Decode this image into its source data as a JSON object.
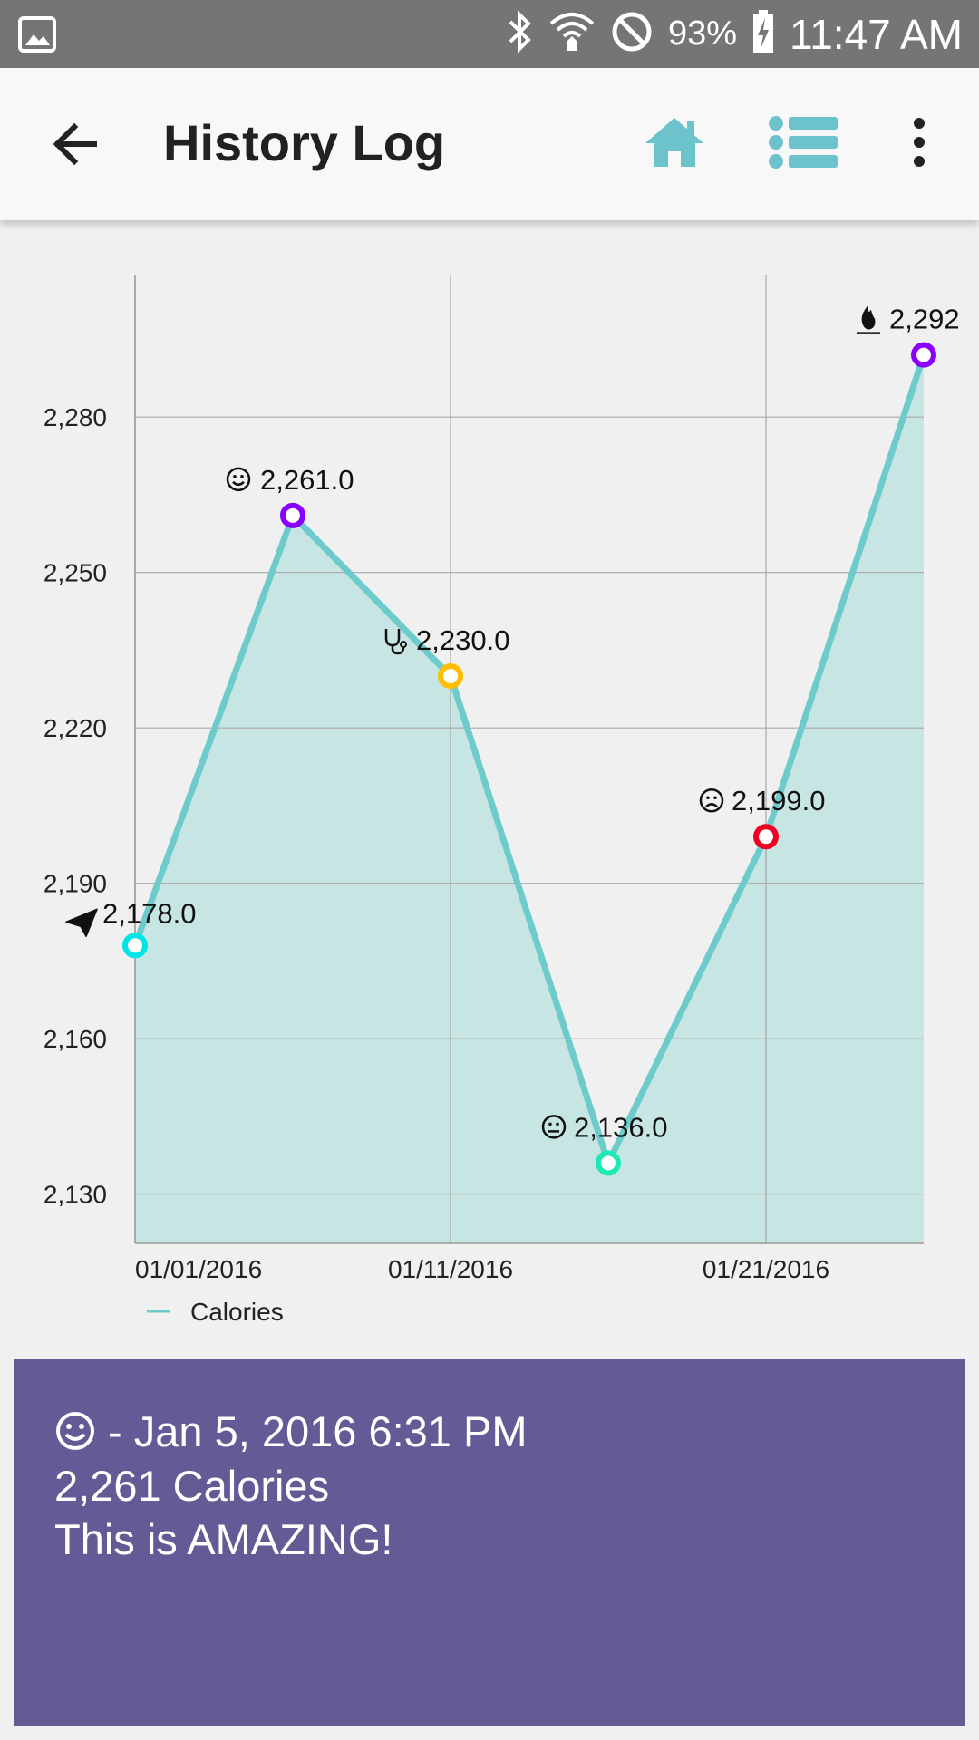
{
  "status_bar": {
    "battery": "93%",
    "time": "11:47 AM",
    "icons": [
      "gallery-icon",
      "bluetooth-icon",
      "wifi-icon",
      "do-not-disturb-icon",
      "battery-charging-icon"
    ]
  },
  "app_bar": {
    "title": "History Log",
    "back_icon": "arrow-back-icon",
    "home_icon": "home-icon",
    "list_icon": "list-icon",
    "more_icon": "more-vert-icon",
    "accent_color": "#6cc3cc"
  },
  "chart_data": {
    "type": "area",
    "x": [
      "2016-01-01",
      "2016-01-06",
      "2016-01-11",
      "2016-01-16",
      "2016-01-21",
      "2016-01-26"
    ],
    "series": [
      {
        "name": "Calories",
        "values": [
          2178.0,
          2261.0,
          2230.0,
          2136.0,
          2199.0,
          2292.0
        ],
        "labels": [
          "2,178.0",
          "2,261.0",
          "2,230.0",
          "2,136.0",
          "2,199.0",
          "2,292"
        ],
        "marker_icons": [
          "paper-plane-icon",
          "smile-icon",
          "stethoscope-icon",
          "neutral-face-icon",
          "sad-face-icon",
          "fire-icon"
        ],
        "marker_colors": [
          "#00e5e5",
          "#8a00ff",
          "#ffbf00",
          "#1de9b6",
          "#ee0022",
          "#8a00ff"
        ],
        "line_color": "#6ecbcc",
        "fill_color": "#c6e5e3"
      }
    ],
    "y_ticks": [
      "2,130",
      "2,160",
      "2,190",
      "2,220",
      "2,250",
      "2,280"
    ],
    "y_tick_values": [
      2130,
      2160,
      2190,
      2220,
      2250,
      2280
    ],
    "x_ticks": [
      "01/01/2016",
      "01/11/2016",
      "01/21/2016"
    ],
    "x_tick_dates": [
      "2016-01-01",
      "2016-01-11",
      "2016-01-21"
    ],
    "ylim": [
      2120.5,
      2307.5
    ],
    "xlim": [
      "2016-01-01",
      "2016-01-26"
    ],
    "grid": true,
    "legend": "bottom-left"
  },
  "detail": {
    "icon": "smile-icon",
    "line1": " - Jan 5, 2016 6:31 PM",
    "line2": "2,261 Calories",
    "line3": "This is AMAZING!",
    "background": "#655996"
  }
}
